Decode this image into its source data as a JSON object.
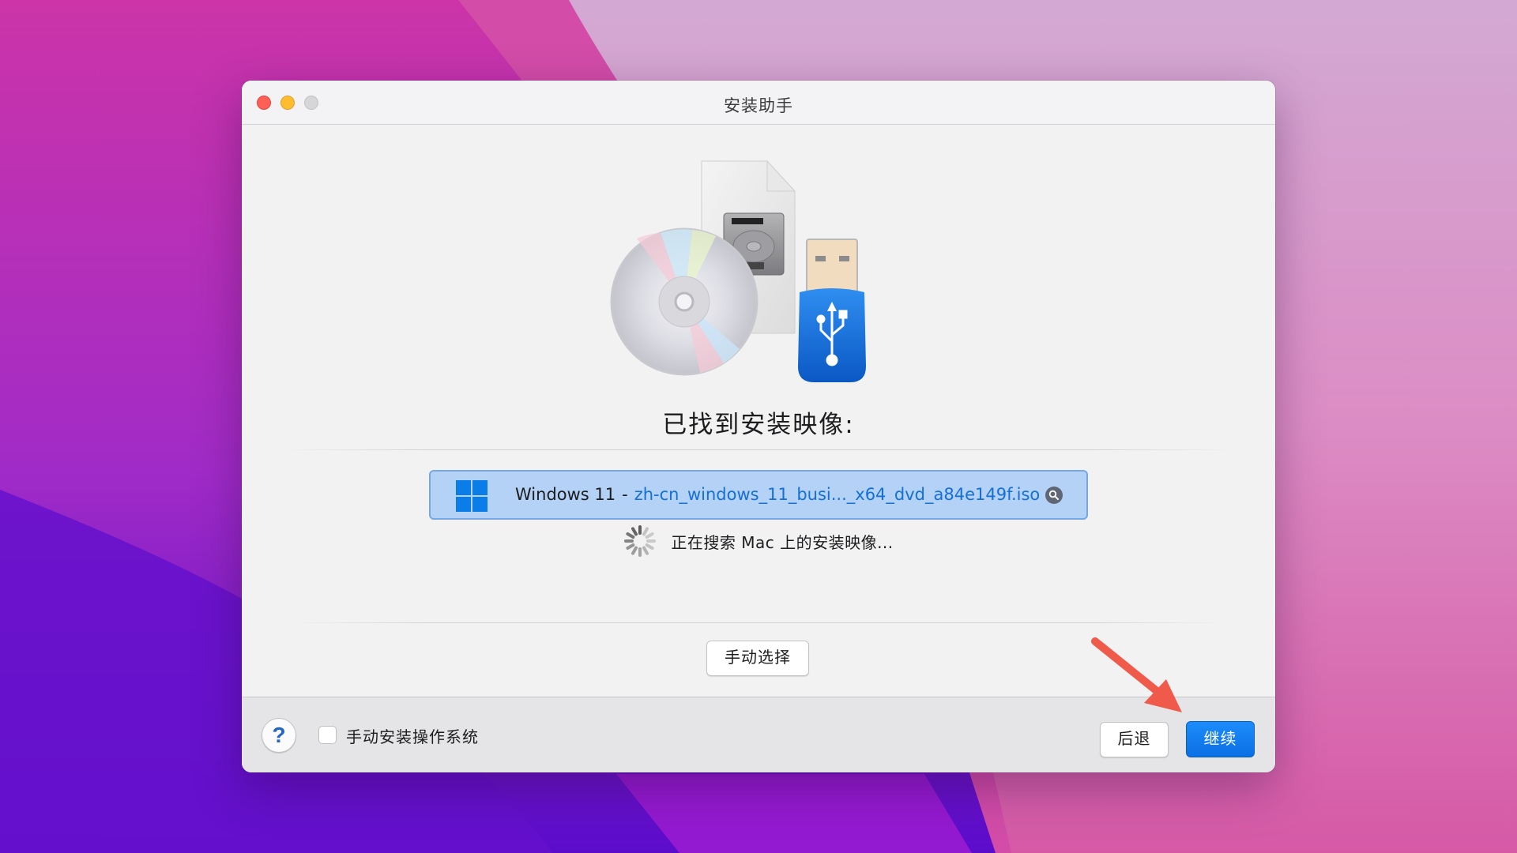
{
  "window": {
    "title": "安装助手",
    "traffic_lights": [
      "close",
      "minimize",
      "zoom"
    ]
  },
  "main": {
    "hero_icons": [
      "disc-icon",
      "disk-image-icon",
      "usb-drive-icon"
    ],
    "heading": "已找到安装映像:",
    "found_image": {
      "os_name": "Windows 11",
      "separator": "-",
      "file_name": "zh-cn_windows_11_busi..._x64_dvd_a84e149f.iso",
      "os_icon": "windows-logo-icon",
      "action_icon": "magnifier-icon",
      "selected": true
    },
    "status_text": "正在搜索 Mac 上的安装映像...",
    "manual_select_label": "手动选择"
  },
  "footer": {
    "help_label": "?",
    "manual_install_checkbox": {
      "label": "手动安装操作系统",
      "checked": false
    },
    "back_label": "后退",
    "continue_label": "继续"
  },
  "colors": {
    "accent": "#0a7de8",
    "selection_bg": "#b4d1f6",
    "selection_border": "#77a8e3",
    "link_text": "#1570d6",
    "annotation_arrow": "#f05a4a"
  }
}
